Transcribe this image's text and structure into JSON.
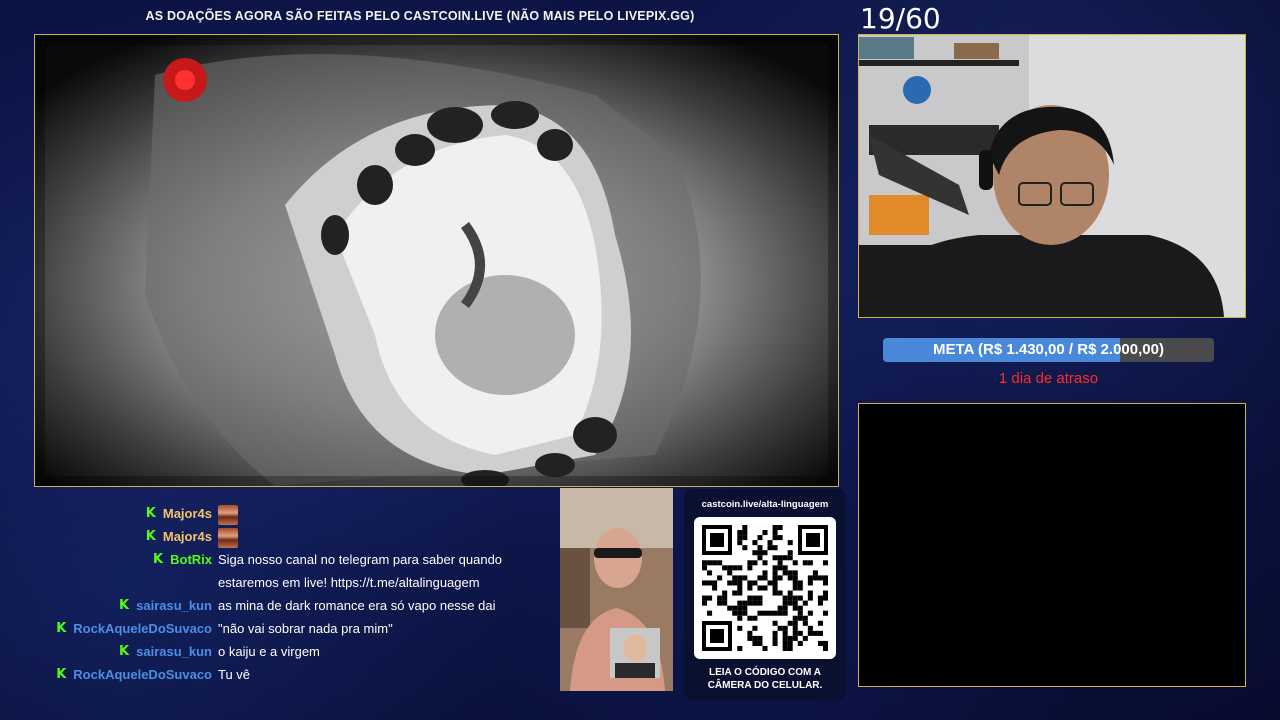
{
  "banner": "AS DOAÇÕES AGORA SÃO FEITAS PELO CASTCOIN.LIVE (NÃO MAIS PELO LIVEPIX.GG)",
  "episode_counter": "19/60",
  "goal": {
    "label": "META (R$ 1.430,00 / R$ 2.000,00)",
    "current": 1430,
    "target": 2000,
    "progress": 0.715,
    "bar_color": "#4a88d9",
    "status": "1 dia de atraso",
    "status_color": "#ff2a2a"
  },
  "chat": [
    {
      "user": "Major4s",
      "color": "#f5c46a",
      "message": "",
      "emote": true
    },
    {
      "user": "Major4s",
      "color": "#f5c46a",
      "message": "",
      "emote": true
    },
    {
      "user": "BotRix",
      "color": "#53fc18",
      "message": "Siga nosso canal no telegram para saber quando estaremos em live! https://t.me/altalinguagem",
      "emote": false
    },
    {
      "user": "sairasu_kun",
      "color": "#4a8ee6",
      "message": "as mina de dark romance era só vapo nesse dai",
      "emote": false
    },
    {
      "user": "RockAqueleDoSuvaco",
      "color": "#4a8ee6",
      "message": "\"não vai sobrar nada pra mim\"",
      "emote": false
    },
    {
      "user": "sairasu_kun",
      "color": "#4a8ee6",
      "message": "o kaiju e a virgem",
      "emote": false
    },
    {
      "user": "RockAqueleDoSuvaco",
      "color": "#4a8ee6",
      "message": "Tu vê",
      "emote": false
    }
  ],
  "chat_badge_icon": "kick-icon",
  "qr": {
    "url": "castcoin.live/alta-linguagem",
    "caption_line1": "LEIA O CÓDIGO COM A",
    "caption_line2": "CÂMERA DO CELULAR."
  },
  "colors": {
    "frame_border": "#d4b04a",
    "background": "#0c1547"
  }
}
